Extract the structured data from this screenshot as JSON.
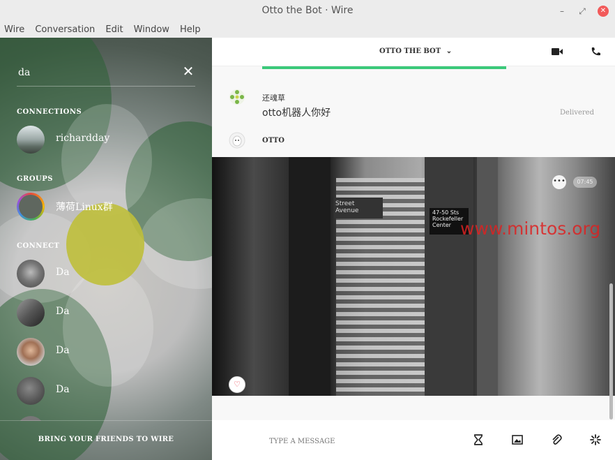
{
  "window": {
    "title": "Otto the Bot · Wire"
  },
  "menu": [
    "Wire",
    "Conversation",
    "Edit",
    "Window",
    "Help"
  ],
  "search": {
    "value": "da"
  },
  "sections": {
    "connections": "CONNECTIONS",
    "groups": "GROUPS",
    "connect": "CONNECT"
  },
  "connections": [
    {
      "name": "richardday"
    }
  ],
  "groups": [
    {
      "name": "薄荷Linux群"
    }
  ],
  "connect": [
    {
      "name": "Da"
    },
    {
      "name": "Da"
    },
    {
      "name": "Da"
    },
    {
      "name": "Da"
    }
  ],
  "invite": {
    "label": "BRING YOUR FRIENDS TO WIRE"
  },
  "conversation": {
    "title": "OTTO THE BOT",
    "upload_progress": 1.0,
    "messages": [
      {
        "sender": "还魂草",
        "text": "otto机器人你好",
        "status": "Delivered"
      }
    ],
    "bot_name": "OTTO",
    "photo": {
      "time": "07:45",
      "street_sign": "Street\nAvenue",
      "station_sign": "47-50 Sts\nRockefeller\nCenter",
      "watermark": "www.mintos.org"
    }
  },
  "composer": {
    "placeholder": "TYPE A MESSAGE"
  },
  "colors": {
    "accent": "#3bc97a",
    "close": "#f25a5a"
  }
}
